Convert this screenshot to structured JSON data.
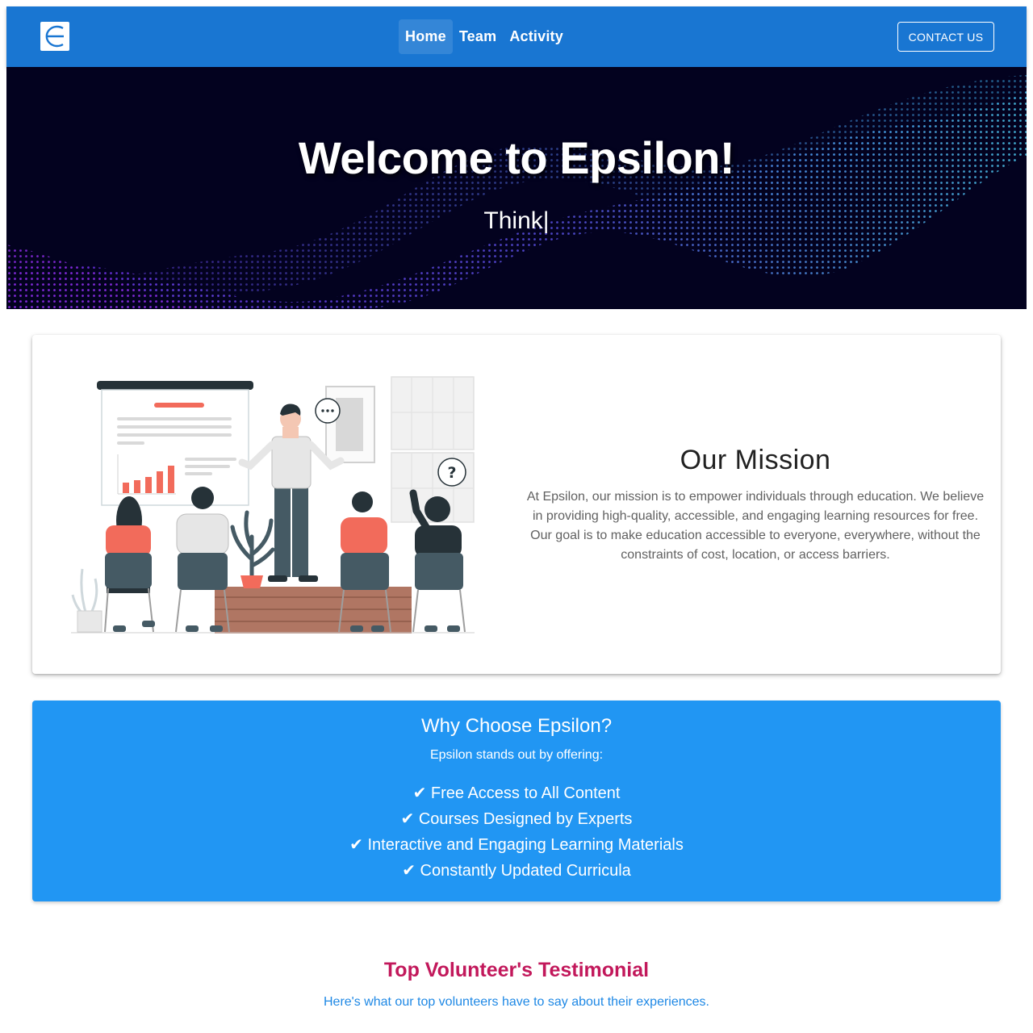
{
  "navbar": {
    "logo_alt": "Epsilon logo",
    "links": [
      {
        "label": "Home",
        "active": true
      },
      {
        "label": "Team",
        "active": false
      },
      {
        "label": "Activity",
        "active": false
      }
    ],
    "contact_label": "CONTACT US",
    "color": "#1976d2"
  },
  "hero": {
    "title": "Welcome to Epsilon!",
    "subtitle": "Think|"
  },
  "mission": {
    "title": "Our Mission",
    "body": "At Epsilon, our mission is to empower individuals through education. We believe in providing high-quality, accessible, and engaging learning resources for free. Our goal is to make education accessible to everyone, everywhere, without the constraints of cost, location, or access barriers."
  },
  "why": {
    "title": "Why Choose Epsilon?",
    "subtitle": "Epsilon stands out by offering:",
    "items": [
      "✔ Free Access to All Content",
      "✔ Courses Designed by Experts",
      "✔ Interactive and Engaging Learning Materials",
      "✔ Constantly Updated Curricula"
    ],
    "color": "#2196f3"
  },
  "testimonial": {
    "title": "Top Volunteer's Testimonial",
    "subtitle": "Here's what our top volunteers have to say about their experiences.",
    "title_color": "#c2185b",
    "subtitle_color": "#1e88e5"
  }
}
